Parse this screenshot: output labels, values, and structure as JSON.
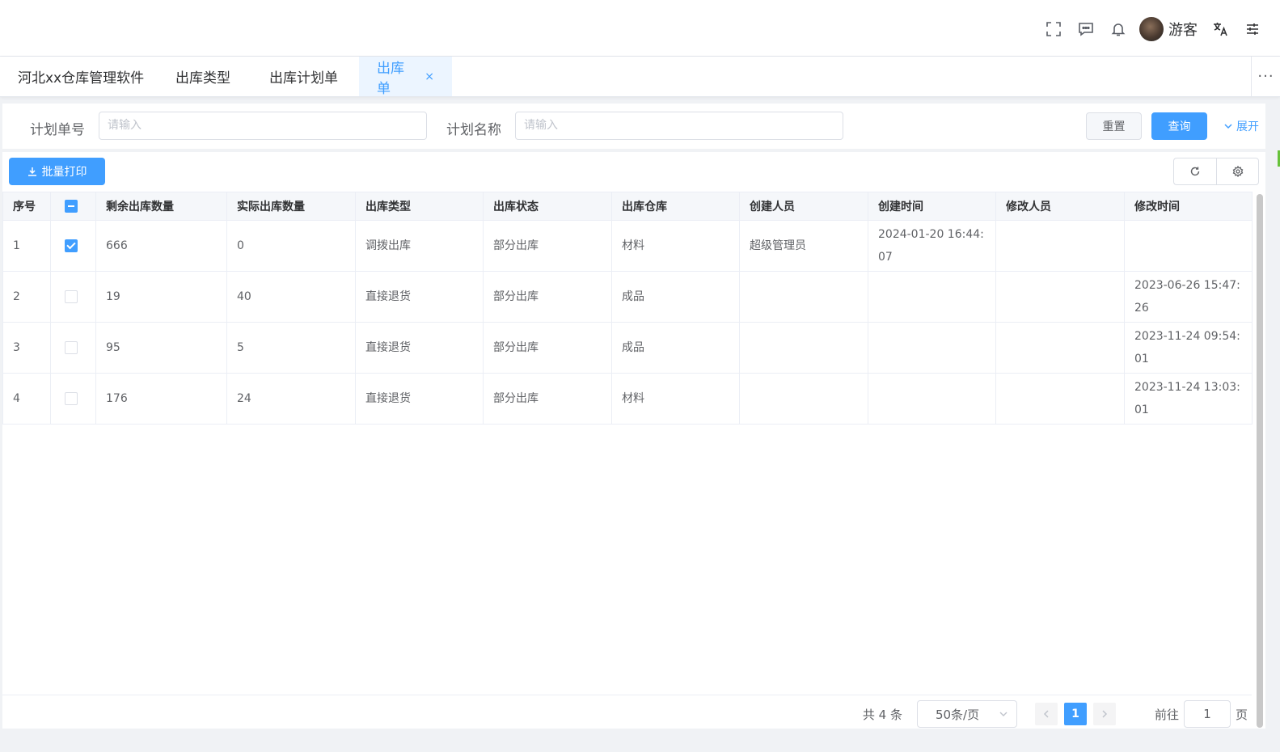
{
  "header": {
    "icons": [
      "fullscreen-icon",
      "message-icon",
      "bell-icon",
      "translate-icon",
      "settings-sliders-icon"
    ],
    "username": "游客"
  },
  "tabs": [
    {
      "label": "河北xx仓库管理软件"
    },
    {
      "label": "出库类型"
    },
    {
      "label": "出库计划单"
    },
    {
      "label": "出库单",
      "active": true,
      "close": "×"
    }
  ],
  "tabs_more": "···",
  "search": {
    "field1_label": "计划单号",
    "field1_placeholder": "请输入",
    "field2_label": "计划名称",
    "field2_placeholder": "请输入",
    "reset_label": "重置",
    "query_label": "查询",
    "expand_label": "展开"
  },
  "toolbar": {
    "batch_print_label": "批量打印"
  },
  "table": {
    "columns": [
      "序号",
      "",
      "剩余出库数量",
      "实际出库数量",
      "出库类型",
      "出库状态",
      "出库仓库",
      "创建人员",
      "创建时间",
      "修改人员",
      "修改时间"
    ],
    "rows": [
      {
        "no": "1",
        "checked": true,
        "remaining": "666",
        "actual": "0",
        "type": "调拨出库",
        "status": "部分出库",
        "warehouse": "材料",
        "creator": "超级管理员",
        "created": "2024-01-20 16:44:07",
        "modifier": "",
        "modified": ""
      },
      {
        "no": "2",
        "checked": false,
        "remaining": "19",
        "actual": "40",
        "type": "直接退货",
        "status": "部分出库",
        "warehouse": "成品",
        "creator": "",
        "created": "",
        "modifier": "",
        "modified": "2023-06-26 15:47:26"
      },
      {
        "no": "3",
        "checked": false,
        "remaining": "95",
        "actual": "5",
        "type": "直接退货",
        "status": "部分出库",
        "warehouse": "成品",
        "creator": "",
        "created": "",
        "modifier": "",
        "modified": "2023-11-24 09:54:01"
      },
      {
        "no": "4",
        "checked": false,
        "remaining": "176",
        "actual": "24",
        "type": "直接退货",
        "status": "部分出库",
        "warehouse": "材料",
        "creator": "",
        "created": "",
        "modifier": "",
        "modified": "2023-11-24 13:03:01"
      }
    ]
  },
  "pagination": {
    "total_text": "共 4 条",
    "page_size": "50条/页",
    "current_page": "1",
    "goto_prefix": "前往",
    "goto_value": "1",
    "goto_suffix": "页"
  }
}
